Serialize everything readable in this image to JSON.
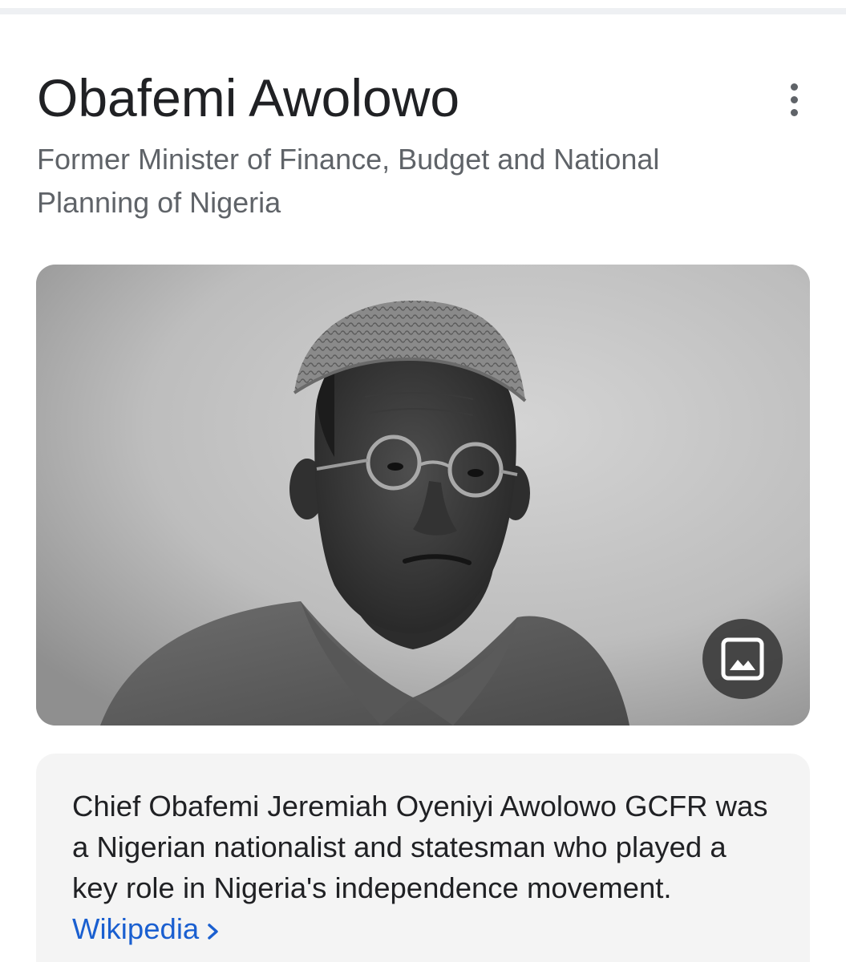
{
  "entity": {
    "title": "Obafemi Awolowo",
    "subtitle": "Former Minister of Finance, Budget and National Planning of Nigeria"
  },
  "actions": {
    "more_icon": "more-vert-icon",
    "image_icon": "image-icon"
  },
  "description": {
    "text": "Chief Obafemi Jeremiah Oyeniyi Awolowo GCFR was a Nigerian nationalist and statesman who played a key role in Nigeria's independence movement.",
    "source_link": "Wikipedia"
  },
  "colors": {
    "title_text": "#202124",
    "secondary_text": "#5f6368",
    "link": "#1a5fd0",
    "card_background": "#f4f4f4",
    "divider": "#eef0f3"
  }
}
